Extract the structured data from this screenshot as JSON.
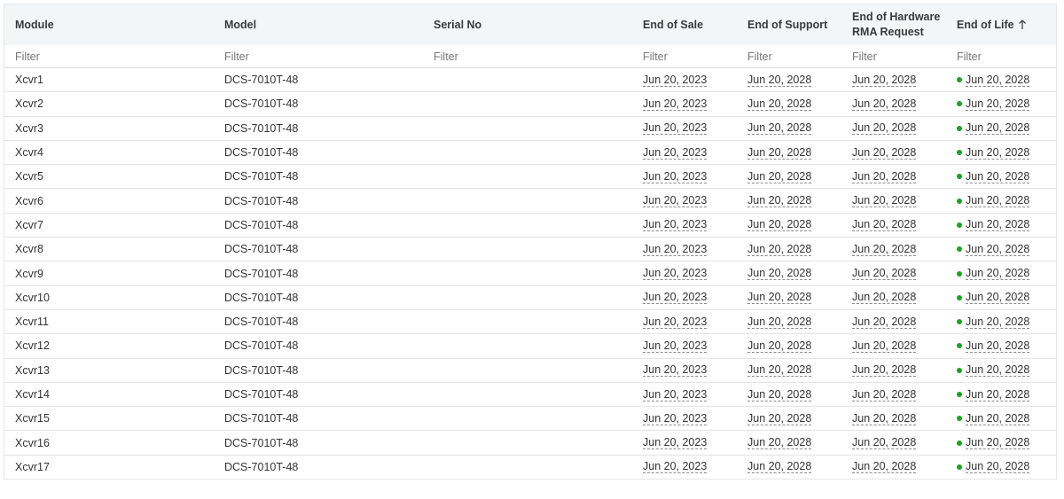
{
  "table": {
    "columns": [
      {
        "label": "Module"
      },
      {
        "label": "Model"
      },
      {
        "label": "Serial No"
      },
      {
        "label": "End of Sale"
      },
      {
        "label": "End of Support"
      },
      {
        "label": "End of Hardware RMA Request"
      },
      {
        "label": "End of Life"
      }
    ],
    "filter_placeholder": "Filter",
    "sort": {
      "column": "End of Life",
      "direction": "ascending",
      "icon": "arrow-up-icon"
    },
    "status_color": "#1aa321",
    "rows": [
      {
        "module": "Xcvr1",
        "model": "DCS-7010T-48",
        "serial": "",
        "eos": "Jun 20, 2023",
        "eosup": "Jun 20, 2028",
        "rma": "Jun 20, 2028",
        "eol": "Jun 20, 2028"
      },
      {
        "module": "Xcvr2",
        "model": "DCS-7010T-48",
        "serial": "",
        "eos": "Jun 20, 2023",
        "eosup": "Jun 20, 2028",
        "rma": "Jun 20, 2028",
        "eol": "Jun 20, 2028"
      },
      {
        "module": "Xcvr3",
        "model": "DCS-7010T-48",
        "serial": "",
        "eos": "Jun 20, 2023",
        "eosup": "Jun 20, 2028",
        "rma": "Jun 20, 2028",
        "eol": "Jun 20, 2028"
      },
      {
        "module": "Xcvr4",
        "model": "DCS-7010T-48",
        "serial": "",
        "eos": "Jun 20, 2023",
        "eosup": "Jun 20, 2028",
        "rma": "Jun 20, 2028",
        "eol": "Jun 20, 2028"
      },
      {
        "module": "Xcvr5",
        "model": "DCS-7010T-48",
        "serial": "",
        "eos": "Jun 20, 2023",
        "eosup": "Jun 20, 2028",
        "rma": "Jun 20, 2028",
        "eol": "Jun 20, 2028"
      },
      {
        "module": "Xcvr6",
        "model": "DCS-7010T-48",
        "serial": "",
        "eos": "Jun 20, 2023",
        "eosup": "Jun 20, 2028",
        "rma": "Jun 20, 2028",
        "eol": "Jun 20, 2028"
      },
      {
        "module": "Xcvr7",
        "model": "DCS-7010T-48",
        "serial": "",
        "eos": "Jun 20, 2023",
        "eosup": "Jun 20, 2028",
        "rma": "Jun 20, 2028",
        "eol": "Jun 20, 2028"
      },
      {
        "module": "Xcvr8",
        "model": "DCS-7010T-48",
        "serial": "",
        "eos": "Jun 20, 2023",
        "eosup": "Jun 20, 2028",
        "rma": "Jun 20, 2028",
        "eol": "Jun 20, 2028"
      },
      {
        "module": "Xcvr9",
        "model": "DCS-7010T-48",
        "serial": "",
        "eos": "Jun 20, 2023",
        "eosup": "Jun 20, 2028",
        "rma": "Jun 20, 2028",
        "eol": "Jun 20, 2028"
      },
      {
        "module": "Xcvr10",
        "model": "DCS-7010T-48",
        "serial": "",
        "eos": "Jun 20, 2023",
        "eosup": "Jun 20, 2028",
        "rma": "Jun 20, 2028",
        "eol": "Jun 20, 2028"
      },
      {
        "module": "Xcvr11",
        "model": "DCS-7010T-48",
        "serial": "",
        "eos": "Jun 20, 2023",
        "eosup": "Jun 20, 2028",
        "rma": "Jun 20, 2028",
        "eol": "Jun 20, 2028"
      },
      {
        "module": "Xcvr12",
        "model": "DCS-7010T-48",
        "serial": "",
        "eos": "Jun 20, 2023",
        "eosup": "Jun 20, 2028",
        "rma": "Jun 20, 2028",
        "eol": "Jun 20, 2028"
      },
      {
        "module": "Xcvr13",
        "model": "DCS-7010T-48",
        "serial": "",
        "eos": "Jun 20, 2023",
        "eosup": "Jun 20, 2028",
        "rma": "Jun 20, 2028",
        "eol": "Jun 20, 2028"
      },
      {
        "module": "Xcvr14",
        "model": "DCS-7010T-48",
        "serial": "",
        "eos": "Jun 20, 2023",
        "eosup": "Jun 20, 2028",
        "rma": "Jun 20, 2028",
        "eol": "Jun 20, 2028"
      },
      {
        "module": "Xcvr15",
        "model": "DCS-7010T-48",
        "serial": "",
        "eos": "Jun 20, 2023",
        "eosup": "Jun 20, 2028",
        "rma": "Jun 20, 2028",
        "eol": "Jun 20, 2028"
      },
      {
        "module": "Xcvr16",
        "model": "DCS-7010T-48",
        "serial": "",
        "eos": "Jun 20, 2023",
        "eosup": "Jun 20, 2028",
        "rma": "Jun 20, 2028",
        "eol": "Jun 20, 2028"
      },
      {
        "module": "Xcvr17",
        "model": "DCS-7010T-48",
        "serial": "",
        "eos": "Jun 20, 2023",
        "eosup": "Jun 20, 2028",
        "rma": "Jun 20, 2028",
        "eol": "Jun 20, 2028"
      }
    ]
  }
}
